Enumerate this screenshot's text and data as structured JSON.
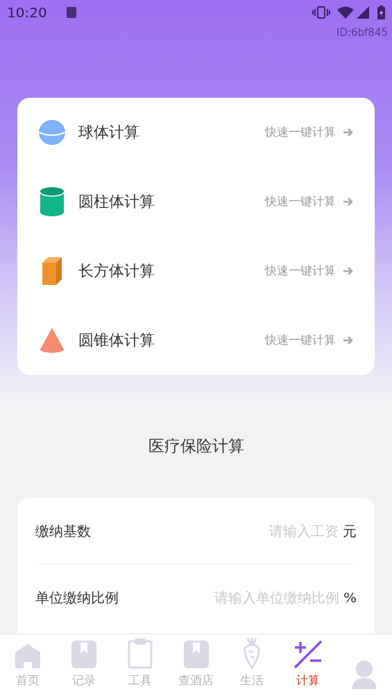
{
  "status_bar": {
    "time": "10:20"
  },
  "header": {
    "id_text": "ID:6bf845"
  },
  "shapes": [
    {
      "kind": "sphere",
      "title": "球体计算",
      "action": "快速一键计算"
    },
    {
      "kind": "cylinder",
      "title": "圆柱体计算",
      "action": "快速一键计算"
    },
    {
      "kind": "cuboid",
      "title": "长方体计算",
      "action": "快速一键计算"
    },
    {
      "kind": "cone",
      "title": "圆锥体计算",
      "action": "快速一键计算"
    }
  ],
  "section_title": "医疗保险计算",
  "form": [
    {
      "label": "缴纳基数",
      "placeholder": "请输入工资",
      "unit": "元"
    },
    {
      "label": "单位缴纳比例",
      "placeholder": "请输入单位缴纳比例",
      "unit": "%"
    }
  ],
  "nav": [
    {
      "kind": "home",
      "label": "首页",
      "selected": false
    },
    {
      "kind": "bookmark",
      "label": "记录",
      "selected": false
    },
    {
      "kind": "clipboard",
      "label": "工具",
      "selected": false
    },
    {
      "kind": "bookmark",
      "label": "查酒店",
      "selected": false
    },
    {
      "kind": "carrot",
      "label": "生活",
      "selected": false
    },
    {
      "kind": "plusminus",
      "label": "计算",
      "selected": true
    },
    {
      "kind": "person",
      "selected": false
    }
  ]
}
